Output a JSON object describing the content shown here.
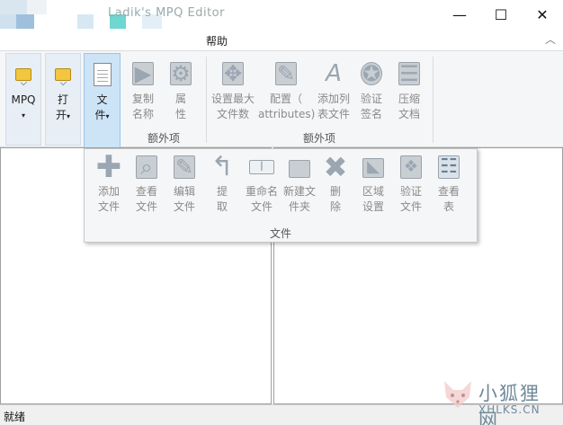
{
  "window": {
    "title": "Ladik's MPQ Editor",
    "min_glyph": "—",
    "max_glyph": "☐",
    "close_glyph": "✕"
  },
  "menu": {
    "help": "帮助",
    "collapse_glyph": "︿"
  },
  "ribbon": {
    "mpq": {
      "line1": "MPQ",
      "caret": "▾"
    },
    "open": {
      "line1": "打",
      "line2": "开",
      "caret": "▾"
    },
    "file": {
      "line1": "文",
      "line2": "件",
      "caret": "▾"
    },
    "copy_name": {
      "line1": "复制",
      "line2": "名称"
    },
    "properties": {
      "line1": "属",
      "line2": "性"
    },
    "set_max_files": {
      "line1": "设置最大",
      "line2": "文件数"
    },
    "config_attributes": {
      "line1": "配置（",
      "line2": "attributes)"
    },
    "add_listfile": {
      "line1": "添加列",
      "line2": "表文件"
    },
    "verify_signature": {
      "line1": "验证",
      "line2": "签名"
    },
    "compress_archive": {
      "line1": "压缩",
      "line2": "文档"
    },
    "group_extra1": "额外项",
    "group_extra2": "额外项"
  },
  "dropdown": {
    "items": [
      {
        "line1": "添加",
        "line2": "文件",
        "icon": "plus-icon"
      },
      {
        "line1": "查看",
        "line2": "文件",
        "icon": "magnifier-icon"
      },
      {
        "line1": "编辑",
        "line2": "文件",
        "icon": "edit-icon"
      },
      {
        "line1": "提",
        "line2": "取",
        "icon": "extract-icon"
      },
      {
        "line1": "重命名",
        "line2": "文件",
        "icon": "rename-icon"
      },
      {
        "line1": "新建文",
        "line2": "件夹",
        "icon": "new-folder-icon"
      },
      {
        "line1": "删",
        "line2": "除",
        "icon": "delete-icon"
      },
      {
        "line1": "区域",
        "line2": "设置",
        "icon": "locale-icon"
      },
      {
        "line1": "验证",
        "line2": "文件",
        "icon": "verify-icon"
      },
      {
        "line1": "查看",
        "line2": "表",
        "icon": "table-icon"
      }
    ],
    "group_label": "文件"
  },
  "status": {
    "text": "就绪"
  },
  "watermark": {
    "text": "小狐狸网",
    "sub": "XHLKS.CN"
  }
}
